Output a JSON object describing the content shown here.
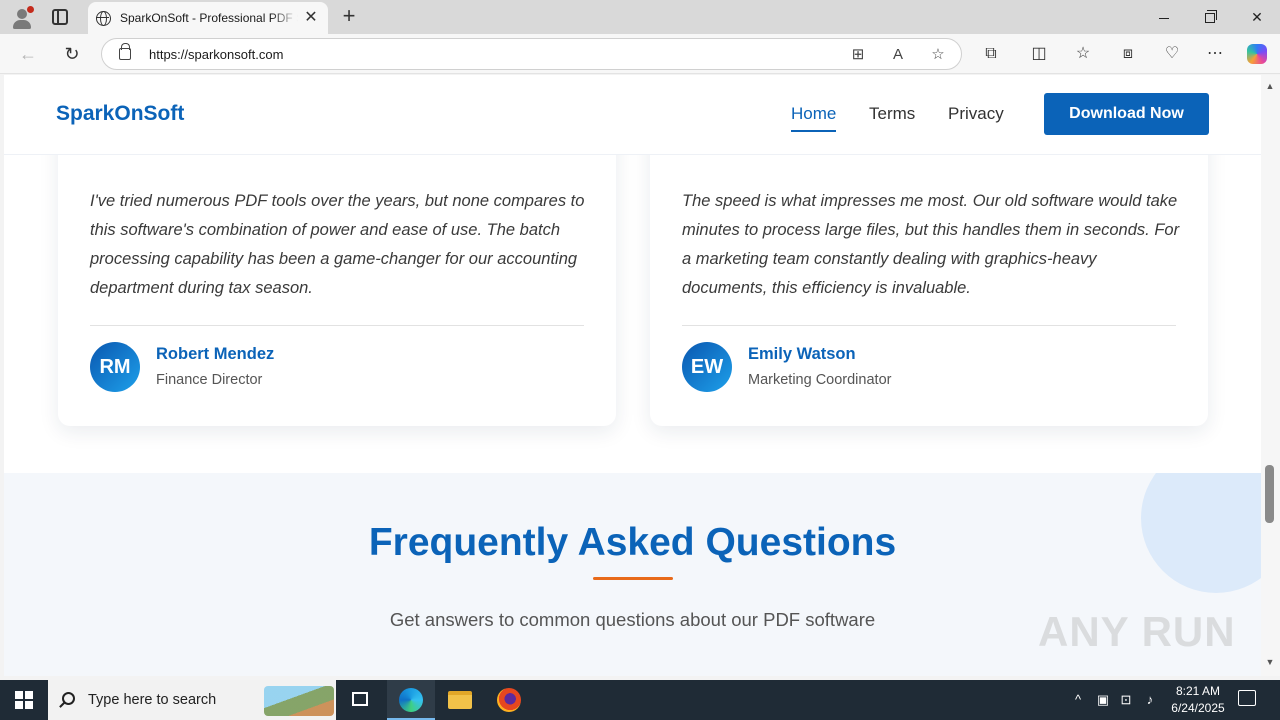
{
  "browser": {
    "tab_title": "SparkOnSoft - Professional PDF Software",
    "tab_close": "✕",
    "new_tab": "+",
    "url": "https://sparkonsoft.com",
    "window_controls": {
      "minimize": "",
      "maximize": "",
      "close": "✕"
    }
  },
  "site": {
    "logo": "SparkOnSoft",
    "nav": [
      "Home",
      "Terms",
      "Privacy"
    ],
    "active_nav": "Home",
    "cta": "Download Now",
    "brand_color": "#0b63b8",
    "accent_color": "#e86a1a"
  },
  "testimonials": [
    {
      "quote": "I've tried numerous PDF tools over the years, but none compares to this software's combination of power and ease of use. The batch processing capability has been a game-changer for our accounting department during tax season.",
      "initials": "RM",
      "name": "Robert Mendez",
      "role": "Finance Director"
    },
    {
      "quote": "The speed is what impresses me most. Our old software would take minutes to process large files, but this handles them in seconds. For a marketing team constantly dealing with graphics-heavy documents, this efficiency is invaluable.",
      "initials": "EW",
      "name": "Emily Watson",
      "role": "Marketing Coordinator"
    }
  ],
  "faq": {
    "title": "Frequently Asked Questions",
    "subtitle": "Get answers to common questions about our PDF software"
  },
  "watermark": "ANY RUN",
  "taskbar": {
    "search_placeholder": "Type here to search",
    "time": "8:21 AM",
    "date": "6/24/2025"
  }
}
